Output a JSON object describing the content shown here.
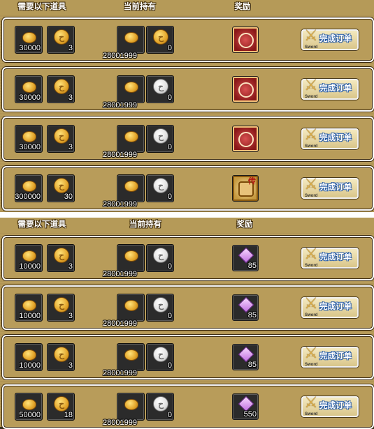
{
  "headers": {
    "required": "需要以下道具",
    "current": "当前持有",
    "reward": "奖励"
  },
  "button": {
    "label": "完成订单",
    "sub": "Sword"
  },
  "icons": {
    "coin": "coin-icon",
    "token": "token-icon",
    "ticket": "ticket-icon",
    "gem": "gem-icon",
    "scroll": "scroll-icon",
    "sword": "sword-icon"
  },
  "colors": {
    "panel": "#b79a58",
    "row_border": "#ffffff",
    "slot_bg": "#2b2b2b",
    "button_text_outline": "#2c5fa6"
  },
  "panels": [
    {
      "rows": [
        {
          "req1": "30000",
          "req2": "3",
          "cur1": "28001999",
          "cur2": "0",
          "reward_type": "red",
          "reward_text": ""
        },
        {
          "req1": "30000",
          "req2": "3",
          "cur1": "28001999",
          "cur2": "0",
          "reward_type": "red",
          "reward_text": ""
        },
        {
          "req1": "30000",
          "req2": "3",
          "cur1": "28001999",
          "cur2": "0",
          "reward_type": "red",
          "reward_text": ""
        },
        {
          "req1": "300000",
          "req2": "30",
          "cur1": "28001999",
          "cur2": "0",
          "reward_type": "gold",
          "reward_text": "传"
        }
      ]
    },
    {
      "rows": [
        {
          "req1": "10000",
          "req2": "3",
          "cur1": "28001999",
          "cur2": "0",
          "reward_type": "gem",
          "reward_text": "85"
        },
        {
          "req1": "10000",
          "req2": "3",
          "cur1": "28001999",
          "cur2": "0",
          "reward_type": "gem",
          "reward_text": "85"
        },
        {
          "req1": "10000",
          "req2": "3",
          "cur1": "28001999",
          "cur2": "0",
          "reward_type": "gem",
          "reward_text": "85"
        },
        {
          "req1": "50000",
          "req2": "18",
          "cur1": "28001999",
          "cur2": "0",
          "reward_type": "gem",
          "reward_text": "550"
        }
      ]
    }
  ]
}
